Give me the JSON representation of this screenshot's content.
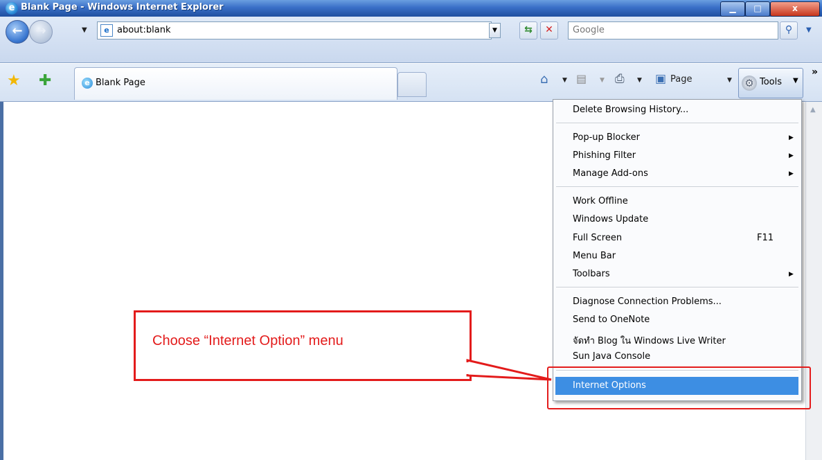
{
  "window": {
    "title": "Blank Page - Windows Internet Explorer",
    "minimize_label": "▁",
    "maximize_label": "□",
    "close_label": "x"
  },
  "address_bar": {
    "url": "about:blank"
  },
  "search": {
    "placeholder": "Google"
  },
  "tab": {
    "label": "Blank Page"
  },
  "command_bar": {
    "page_label": "Page",
    "tools_label": "Tools"
  },
  "tools_menu": {
    "groups": [
      [
        {
          "label": "Delete Browsing History..."
        }
      ],
      [
        {
          "label": "Pop-up Blocker",
          "submenu": true
        },
        {
          "label": "Phishing Filter",
          "submenu": true
        },
        {
          "label": "Manage Add-ons",
          "submenu": true
        }
      ],
      [
        {
          "label": "Work Offline"
        },
        {
          "label": "Windows Update"
        },
        {
          "label": "Full Screen",
          "shortcut": "F11"
        },
        {
          "label": "Menu Bar"
        },
        {
          "label": "Toolbars",
          "submenu": true
        }
      ],
      [
        {
          "label": "Diagnose Connection Problems..."
        },
        {
          "label": "Send to OneNote"
        },
        {
          "label": "จัดทำ Blog ใน Windows Live Writer"
        },
        {
          "label": "Sun Java Console"
        }
      ],
      [
        {
          "label": "Internet Options",
          "highlighted": true
        }
      ]
    ]
  },
  "annotation": {
    "callout_text": "Choose “Internet Option” menu",
    "color": "#e31b1b"
  },
  "colors": {
    "menu_highlight": "#3d8ee3",
    "titlebar": "#3a6fc7"
  }
}
